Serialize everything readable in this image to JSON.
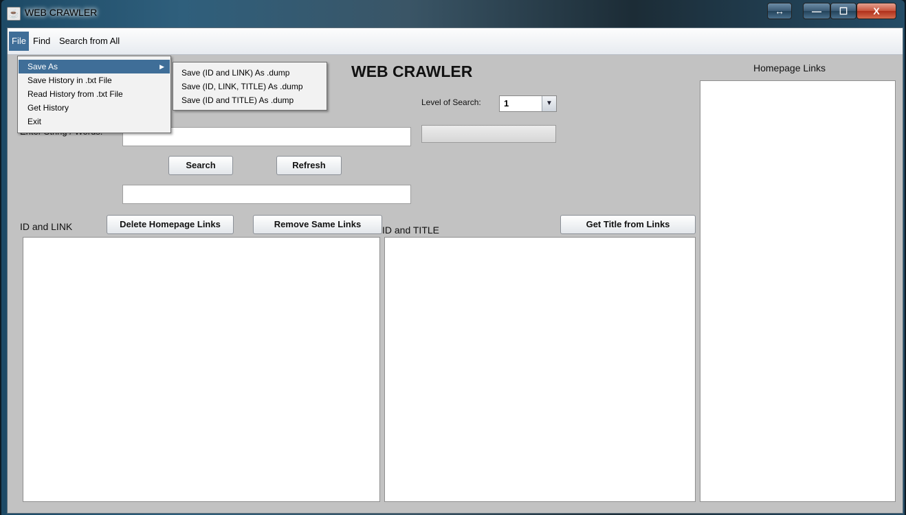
{
  "window": {
    "title": "WEB CRAWLER",
    "controls": {
      "resize": "↔",
      "minimize": "—",
      "maximize": "☐",
      "close": "X"
    }
  },
  "menubar": {
    "items": [
      "File",
      "Find",
      "Search from All"
    ]
  },
  "file_menu": {
    "items": [
      "Save As",
      "Save History in .txt File",
      "Read History from .txt File",
      "Get History",
      "Exit"
    ],
    "highlighted": "Save As"
  },
  "save_as_submenu": {
    "items": [
      "Save (ID and LINK) As .dump",
      "Save (ID, LINK, TITLE) As .dump",
      "Save (ID and TITLE) As .dump"
    ]
  },
  "main": {
    "title": "WEB CRAWLER",
    "enter_string_label": "Enter String / Words:",
    "search_input_value": "",
    "result_field_value": "",
    "level_label": "Level of Search:",
    "level_value": "1",
    "search_button": "Search",
    "refresh_button": "Refresh",
    "id_link_label": "ID and LINK",
    "delete_homepage_links_button": "Delete Homepage Links",
    "remove_same_links_button": "Remove Same Links",
    "id_title_label": "ID and TITLE",
    "get_title_button": "Get Title from Links",
    "homepage_links_label": "Homepage Links"
  },
  "colors": {
    "menu_highlight": "#3f6e98",
    "client_background": "#c2c2c2",
    "close_button": "#c8533c"
  }
}
